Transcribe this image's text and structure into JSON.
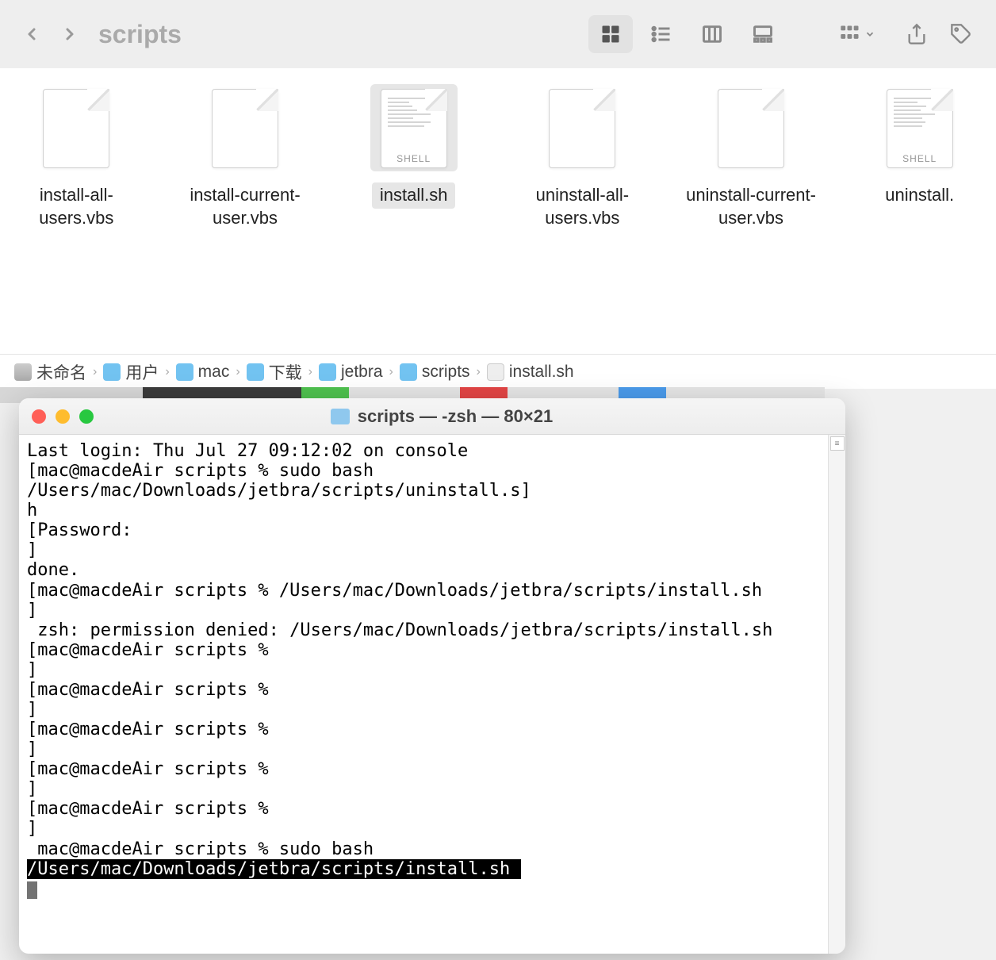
{
  "finder": {
    "title": "scripts",
    "files": [
      {
        "name": "install-all-users.vbs",
        "type": "doc",
        "selected": false
      },
      {
        "name": "install-current-user.vbs",
        "type": "doc",
        "selected": false
      },
      {
        "name": "install.sh",
        "type": "shell",
        "selected": true
      },
      {
        "name": "uninstall-all-users.vbs",
        "type": "doc",
        "selected": false
      },
      {
        "name": "uninstall-current-user.vbs",
        "type": "doc",
        "selected": false
      },
      {
        "name": "uninstall.",
        "type": "shell",
        "selected": false
      }
    ],
    "shell_badge": "SHELL",
    "path": [
      "未命名",
      "用户",
      "mac",
      "下载",
      "jetbra",
      "scripts",
      "install.sh"
    ]
  },
  "terminal": {
    "title": "scripts — -zsh — 80×21",
    "lines": {
      "login": "Last login: Thu Jul 27 09:12:02 on console",
      "p1a": "[mac@macdeAir scripts % sudo bash /Users/mac/Downloads/jetbra/scripts/uninstall.s]",
      "p1b": "h",
      "pw": "[Password:                                                                       ]",
      "done": "done.",
      "p2": "[mac@macdeAir scripts % /Users/mac/Downloads/jetbra/scripts/install.sh           ]",
      "err": " zsh: permission denied: /Users/mac/Downloads/jetbra/scripts/install.sh",
      "empty": "[mac@macdeAir scripts %                                                          ]",
      "last_prefix": " mac@macdeAir scripts % sudo bash ",
      "last_hl": "/Users/mac/Downloads/jetbra/scripts/install.sh "
    }
  }
}
